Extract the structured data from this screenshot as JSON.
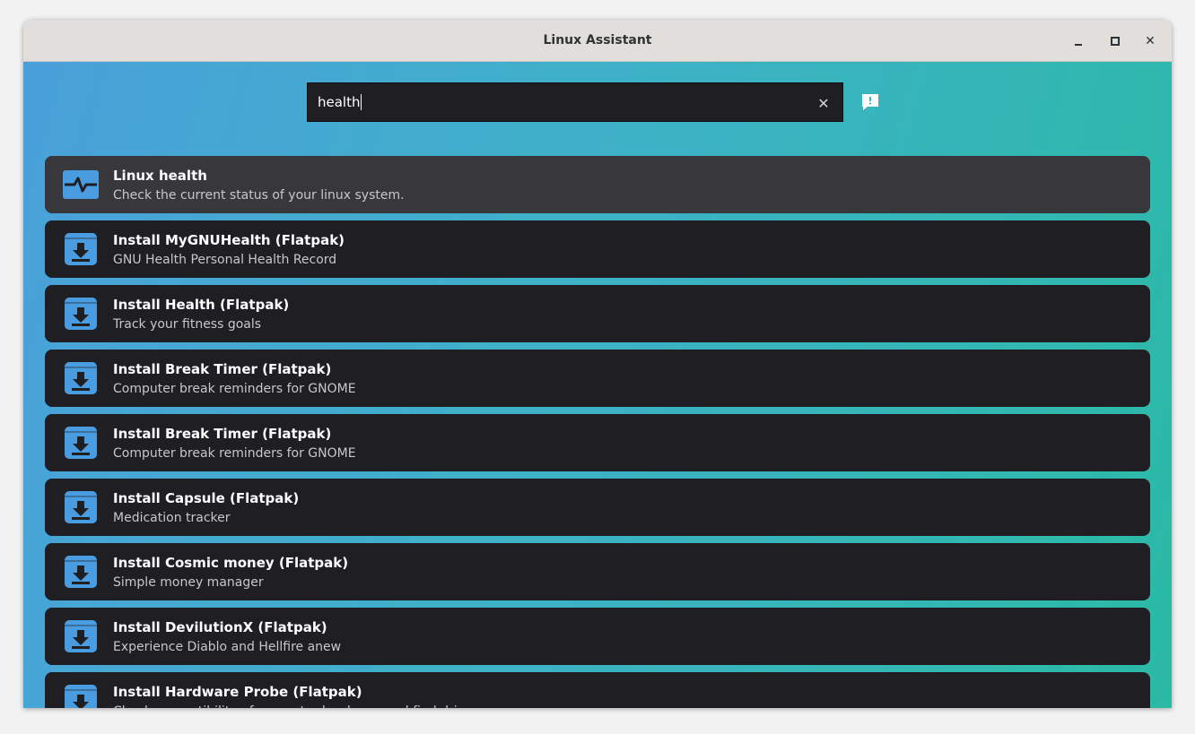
{
  "window": {
    "title": "Linux Assistant"
  },
  "search": {
    "value": "health"
  },
  "results": [
    {
      "title": "Linux health",
      "subtitle": "Check the current status of your linux system.",
      "icon": "health-icon",
      "selected": true
    },
    {
      "title": "Install MyGNUHealth (Flatpak)",
      "subtitle": "GNU Health Personal Health Record",
      "icon": "download-icon"
    },
    {
      "title": "Install Health (Flatpak)",
      "subtitle": "Track your fitness goals",
      "icon": "download-icon"
    },
    {
      "title": "Install Break Timer (Flatpak)",
      "subtitle": "Computer break reminders for GNOME",
      "icon": "download-icon"
    },
    {
      "title": "Install Break Timer (Flatpak)",
      "subtitle": "Computer break reminders for GNOME",
      "icon": "download-icon"
    },
    {
      "title": "Install Capsule (Flatpak)",
      "subtitle": "Medication tracker",
      "icon": "download-icon"
    },
    {
      "title": "Install Cosmic money (Flatpak)",
      "subtitle": "Simple money manager",
      "icon": "download-icon"
    },
    {
      "title": "Install DevilutionX (Flatpak)",
      "subtitle": "Experience Diablo and Hellfire anew",
      "icon": "download-icon"
    },
    {
      "title": "Install Hardware Probe (Flatpak)",
      "subtitle": "Check compatibility of computer hardware and find drivers",
      "icon": "download-icon"
    }
  ],
  "colors": {
    "icon_blue": "#4a9ce0",
    "row_bg": "#1f1e23",
    "row_selected_bg": "#38373c"
  }
}
